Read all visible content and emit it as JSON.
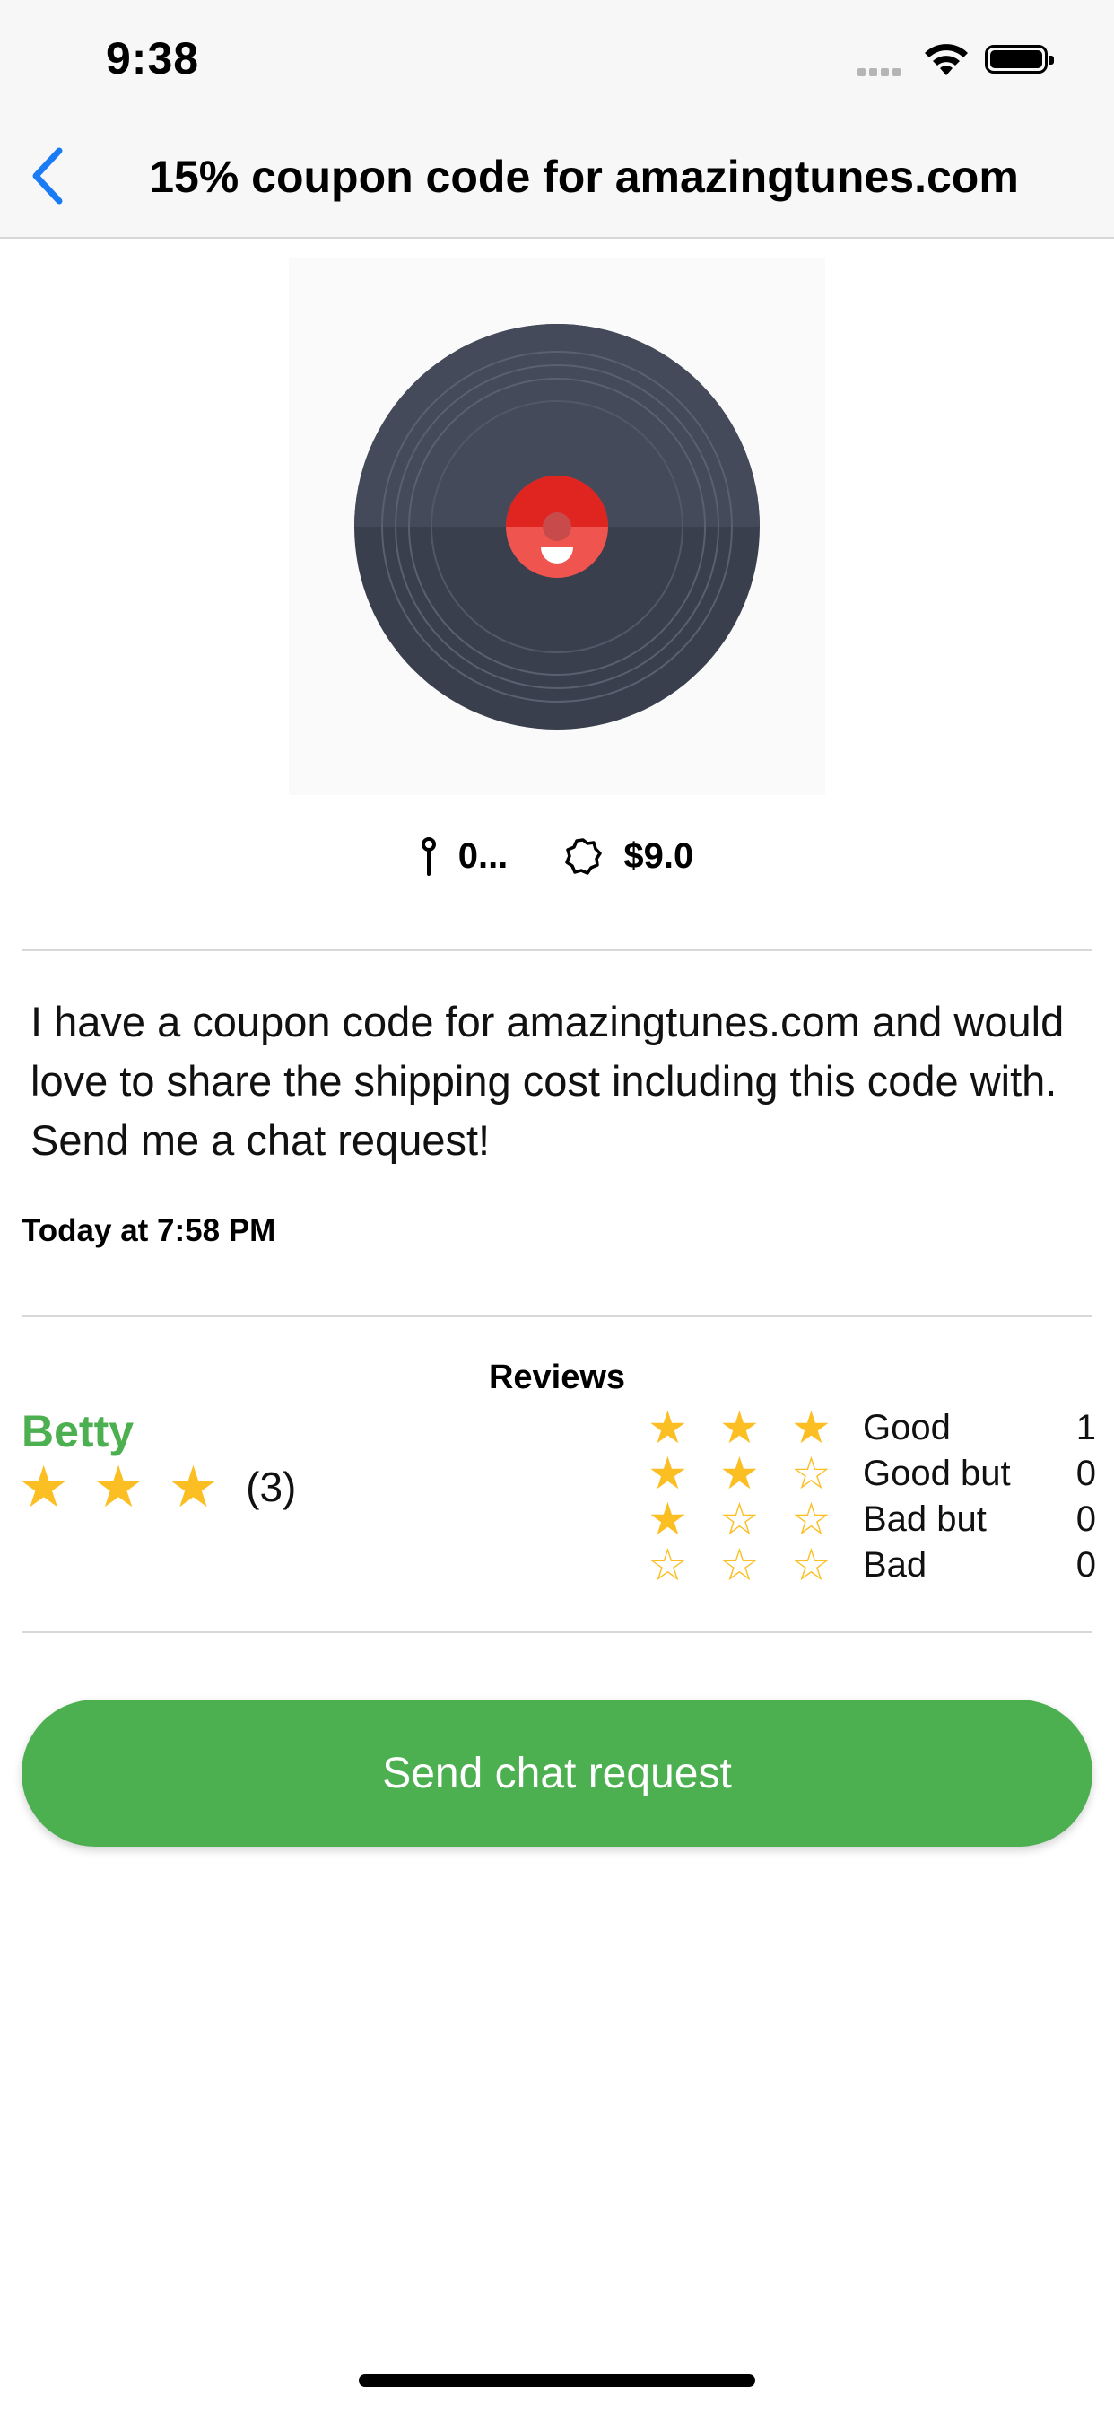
{
  "status_bar": {
    "time": "9:38"
  },
  "nav": {
    "title": "15% coupon code for amazingtunes.com"
  },
  "listing": {
    "distance": "0...",
    "price": "$9.0",
    "description": "I have a coupon code for amazingtunes.com and would love to share the shipping cost including this code with. Send me a chat request!",
    "posted": "Today at 7:58 PM"
  },
  "reviews": {
    "title": "Reviews",
    "user": {
      "name": "Betty",
      "stars": 3,
      "count_label": "(3)"
    },
    "breakdown": [
      {
        "label": "Good",
        "filled": 3,
        "count": "1"
      },
      {
        "label": "Good but",
        "filled": 2,
        "count": "0"
      },
      {
        "label": "Bad but",
        "filled": 1,
        "count": "0"
      },
      {
        "label": "Bad",
        "filled": 0,
        "count": "0"
      }
    ]
  },
  "actions": {
    "chat_button": "Send chat request"
  },
  "colors": {
    "accent_green": "#4caf50",
    "star": "#fbbf24",
    "back_blue": "#1a7cf5",
    "record": "#3a3f4e",
    "label_red": "#e8312c"
  },
  "icons": [
    "back-chevron-icon",
    "location-pin-icon",
    "price-badge-icon",
    "wifi-icon",
    "battery-icon",
    "star-icon"
  ]
}
